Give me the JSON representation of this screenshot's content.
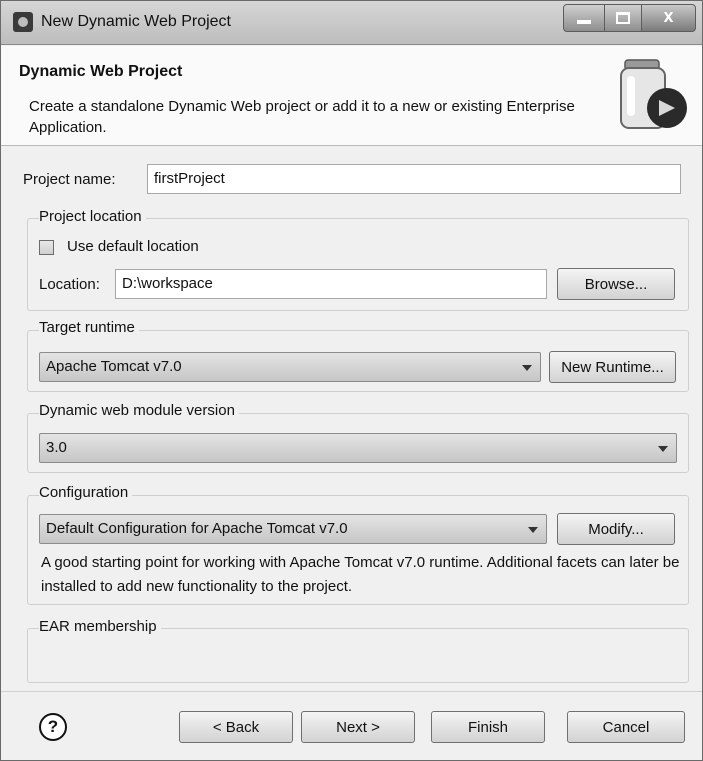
{
  "window": {
    "title": "New Dynamic Web Project",
    "controls": {
      "minimize_icon": "minimize-icon",
      "maximize_icon": "maximize-icon",
      "close_label": "X"
    }
  },
  "banner": {
    "title": "Dynamic Web Project",
    "description": "Create a standalone Dynamic Web project or add it to a new or existing Enterprise Application."
  },
  "project_name": {
    "label": "Project name:",
    "value": "firstProject"
  },
  "project_location": {
    "group_title": "Project location",
    "use_default_label": "Use default location",
    "use_default_checked": false,
    "location_label": "Location:",
    "location_value": "D:\\workspace",
    "browse_label": "Browse..."
  },
  "target_runtime": {
    "group_title": "Target runtime",
    "selected": "Apache Tomcat v7.0",
    "new_runtime_label": "New Runtime..."
  },
  "module_version": {
    "group_title": "Dynamic web module version",
    "selected": "3.0"
  },
  "configuration": {
    "group_title": "Configuration",
    "selected": "Default Configuration for Apache Tomcat v7.0",
    "modify_label": "Modify...",
    "description": "A good starting point for working with Apache Tomcat v7.0 runtime. Additional facets can later be installed to add new functionality to the project."
  },
  "ear_membership": {
    "group_title": "EAR membership"
  },
  "footer": {
    "help_label": "?",
    "back_label": "< Back",
    "next_label": "Next >",
    "finish_label": "Finish",
    "cancel_label": "Cancel"
  },
  "icons": {
    "app": "eclipse-icon",
    "banner": "jar-globe-icon",
    "help": "help-icon",
    "dropdown": "chevron-down-icon"
  }
}
